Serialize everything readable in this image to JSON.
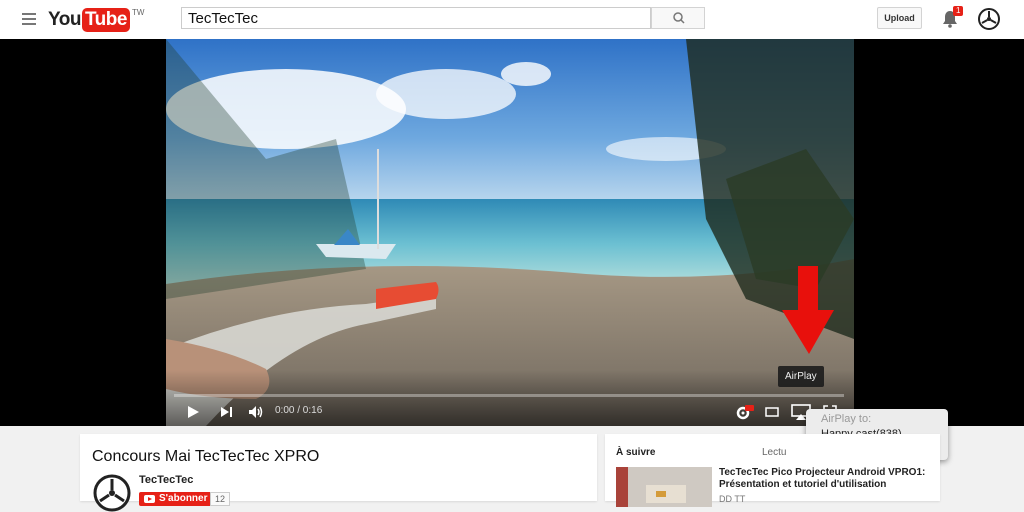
{
  "header": {
    "logo_you": "You",
    "logo_tube": "Tube",
    "logo_region": "TW",
    "search_value": "TecTecTec",
    "upload_label": "Upload",
    "notification_count": "1"
  },
  "player": {
    "time": "0:00 / 0:16",
    "airplay_tooltip": "AirPlay",
    "airplay_menu_title": "AirPlay to:",
    "airplay_device": "Happy cast(838)"
  },
  "video_info": {
    "title": "Concours Mai TecTecTec XPRO",
    "channel": "TecTecTec",
    "subscribe_label": "S'abonner",
    "subscriber_count": "12"
  },
  "sidebar": {
    "up_next_label": "À suivre",
    "autoplay_label": "Lectu",
    "next_title": "TecTecTec Pico Projecteur Android VPRO1: Présentation et tutoriel d'utilisation",
    "next_channel": "DD TT"
  },
  "colors": {
    "brand_red": "#e62117",
    "airplay_arrow": "#e8100c"
  }
}
